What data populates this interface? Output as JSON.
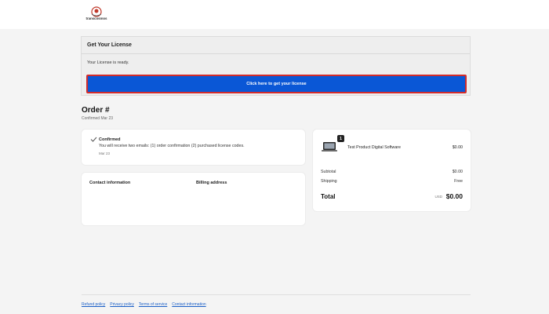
{
  "brand": {
    "name": "transcosmos"
  },
  "license": {
    "heading": "Get Your License",
    "status": "Your License is ready.",
    "button_label": "Click here to get your license"
  },
  "order": {
    "title": "Order #",
    "confirmed_date": "Confirmed Mar 23"
  },
  "confirmation": {
    "title": "Confirmed",
    "message": "You will receive two emails: (1) order confirmation (2) purchased license codes.",
    "date": "Mar 23"
  },
  "info": {
    "contact_label": "Contact information",
    "billing_label": "Billing address"
  },
  "summary": {
    "product_name": "Test Product Digital Software",
    "product_price": "$0.00",
    "quantity": "1",
    "subtotal_label": "Subtotal",
    "subtotal_value": "$0.00",
    "shipping_label": "Shipping",
    "shipping_value": "Free",
    "total_label": "Total",
    "currency": "USD",
    "total_value": "$0.00"
  },
  "footer": {
    "links": [
      "Refund policy",
      "Privacy policy",
      "Terms of service",
      "Contact information"
    ]
  },
  "colors": {
    "button_bg": "#0a57d6",
    "button_border": "#d12b2b",
    "link": "#1a5fc7"
  }
}
